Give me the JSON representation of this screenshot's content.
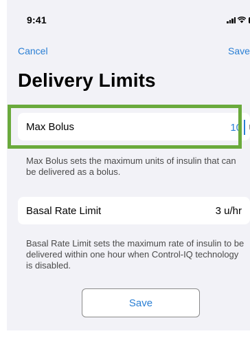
{
  "status_bar": {
    "time": "9:41",
    "icons": [
      "signal-icon",
      "wifi-icon",
      "battery-icon"
    ]
  },
  "nav": {
    "cancel_label": "Cancel",
    "save_label": "Save"
  },
  "page": {
    "title": "Delivery Limits"
  },
  "max_bolus": {
    "label": "Max Bolus",
    "value": "10",
    "unit": "u",
    "description": "Max Bolus sets the maximum units of insulin that can be delivered as a bolus."
  },
  "basal_rate_limit": {
    "label": "Basal Rate Limit",
    "value": "3 u/hr",
    "description": "Basal Rate Limit sets the maximum rate of insulin to be delivered within one hour when Control-IQ technology is disabled."
  },
  "footer": {
    "save_label": "Save"
  },
  "colors": {
    "accent": "#2a7fd4",
    "highlight": "#6aaa3c",
    "background": "#f2f2f7"
  }
}
